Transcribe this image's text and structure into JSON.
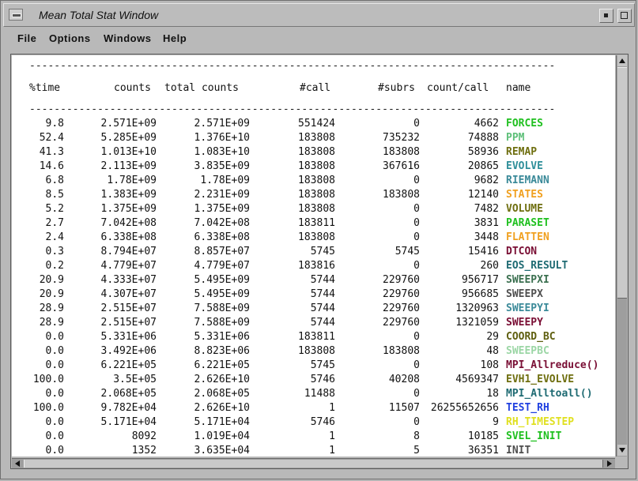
{
  "window": {
    "title": "Mean Total Stat Window"
  },
  "menubar": {
    "items": [
      "File",
      "Options",
      "Windows",
      "Help"
    ]
  },
  "table": {
    "separator": "-------------------------------------------------------------------------------------",
    "headers": {
      "time": "%time",
      "counts": "counts",
      "total": "total counts",
      "call": "#call",
      "subrs": "#subrs",
      "per_call": "count/call",
      "name": "name"
    },
    "rows": [
      {
        "time": "9.8",
        "counts": "2.571E+09",
        "total": "2.571E+09",
        "call": "551424",
        "subrs": "0",
        "per_call": "4662",
        "name": "FORCES",
        "color": "#20c020"
      },
      {
        "time": "52.4",
        "counts": "5.285E+09",
        "total": "1.376E+10",
        "call": "183808",
        "subrs": "735232",
        "per_call": "74888",
        "name": "PPM",
        "color": "#5fc07a"
      },
      {
        "time": "41.3",
        "counts": "1.013E+10",
        "total": "1.083E+10",
        "call": "183808",
        "subrs": "183808",
        "per_call": "58936",
        "name": "REMAP",
        "color": "#6f6f10"
      },
      {
        "time": "14.6",
        "counts": "2.113E+09",
        "total": "3.835E+09",
        "call": "183808",
        "subrs": "367616",
        "per_call": "20865",
        "name": "EVOLVE",
        "color": "#2f8f9a"
      },
      {
        "time": "6.8",
        "counts": "1.78E+09",
        "total": "1.78E+09",
        "call": "183808",
        "subrs": "0",
        "per_call": "9682",
        "name": "RIEMANN",
        "color": "#3b8a99"
      },
      {
        "time": "8.5",
        "counts": "1.383E+09",
        "total": "2.231E+09",
        "call": "183808",
        "subrs": "183808",
        "per_call": "12140",
        "name": "STATES",
        "color": "#f0a020"
      },
      {
        "time": "5.2",
        "counts": "1.375E+09",
        "total": "1.375E+09",
        "call": "183808",
        "subrs": "0",
        "per_call": "7482",
        "name": "VOLUME",
        "color": "#6f6f10"
      },
      {
        "time": "2.7",
        "counts": "7.042E+08",
        "total": "7.042E+08",
        "call": "183811",
        "subrs": "0",
        "per_call": "3831",
        "name": "PARASET",
        "color": "#20c020"
      },
      {
        "time": "2.4",
        "counts": "6.338E+08",
        "total": "6.338E+08",
        "call": "183808",
        "subrs": "0",
        "per_call": "3448",
        "name": "FLATTEN",
        "color": "#f0a020"
      },
      {
        "time": "0.3",
        "counts": "8.794E+07",
        "total": "8.857E+07",
        "call": "5745",
        "subrs": "5745",
        "per_call": "15416",
        "name": "DTCON",
        "color": "#7a0f35"
      },
      {
        "time": "0.2",
        "counts": "4.779E+07",
        "total": "4.779E+07",
        "call": "183816",
        "subrs": "0",
        "per_call": "260",
        "name": "EOS_RESULT",
        "color": "#1f6b73"
      },
      {
        "time": "20.9",
        "counts": "4.333E+07",
        "total": "5.495E+09",
        "call": "5744",
        "subrs": "229760",
        "per_call": "956717",
        "name": "SWEEPXI",
        "color": "#3a6f4f"
      },
      {
        "time": "20.9",
        "counts": "4.307E+07",
        "total": "5.495E+09",
        "call": "5744",
        "subrs": "229760",
        "per_call": "956685",
        "name": "SWEEPX",
        "color": "#4f4f4f"
      },
      {
        "time": "28.9",
        "counts": "2.515E+07",
        "total": "7.588E+09",
        "call": "5744",
        "subrs": "229760",
        "per_call": "1320963",
        "name": "SWEEPYI",
        "color": "#3b8a99"
      },
      {
        "time": "28.9",
        "counts": "2.515E+07",
        "total": "7.588E+09",
        "call": "5744",
        "subrs": "229760",
        "per_call": "1321059",
        "name": "SWEEPY",
        "color": "#7a0f35"
      },
      {
        "time": "0.0",
        "counts": "5.331E+06",
        "total": "5.331E+06",
        "call": "183811",
        "subrs": "0",
        "per_call": "29",
        "name": "COORD_BC",
        "color": "#5f5f10"
      },
      {
        "time": "0.0",
        "counts": "3.492E+06",
        "total": "8.823E+06",
        "call": "183808",
        "subrs": "183808",
        "per_call": "48",
        "name": "SWEEPBC",
        "color": "#9bd6a5"
      },
      {
        "time": "0.0",
        "counts": "6.221E+05",
        "total": "6.221E+05",
        "call": "5745",
        "subrs": "0",
        "per_call": "108",
        "name": "MPI_Allreduce()",
        "color": "#7a0f35"
      },
      {
        "time": "100.0",
        "counts": "3.5E+05",
        "total": "2.626E+10",
        "call": "5746",
        "subrs": "40208",
        "per_call": "4569347",
        "name": "EVH1_EVOLVE",
        "color": "#6f6f10"
      },
      {
        "time": "0.0",
        "counts": "2.068E+05",
        "total": "2.068E+05",
        "call": "11488",
        "subrs": "0",
        "per_call": "18",
        "name": "MPI_Alltoall()",
        "color": "#1f6b73"
      },
      {
        "time": "100.0",
        "counts": "9.782E+04",
        "total": "2.626E+10",
        "call": "1",
        "subrs": "11507",
        "per_call": "26255652656",
        "name": "TEST_RH",
        "color": "#2040e0"
      },
      {
        "time": "0.0",
        "counts": "5.171E+04",
        "total": "5.171E+04",
        "call": "5746",
        "subrs": "0",
        "per_call": "9",
        "name": "RH_TIMESTEP",
        "color": "#e0e020"
      },
      {
        "time": "0.0",
        "counts": "8092",
        "total": "1.019E+04",
        "call": "1",
        "subrs": "8",
        "per_call": "10185",
        "name": "SVEL_INIT",
        "color": "#20c020"
      },
      {
        "time": "0.0",
        "counts": "1352",
        "total": "3.635E+04",
        "call": "1",
        "subrs": "5",
        "per_call": "36351",
        "name": "INIT",
        "color": "#4f4f4f"
      }
    ]
  }
}
